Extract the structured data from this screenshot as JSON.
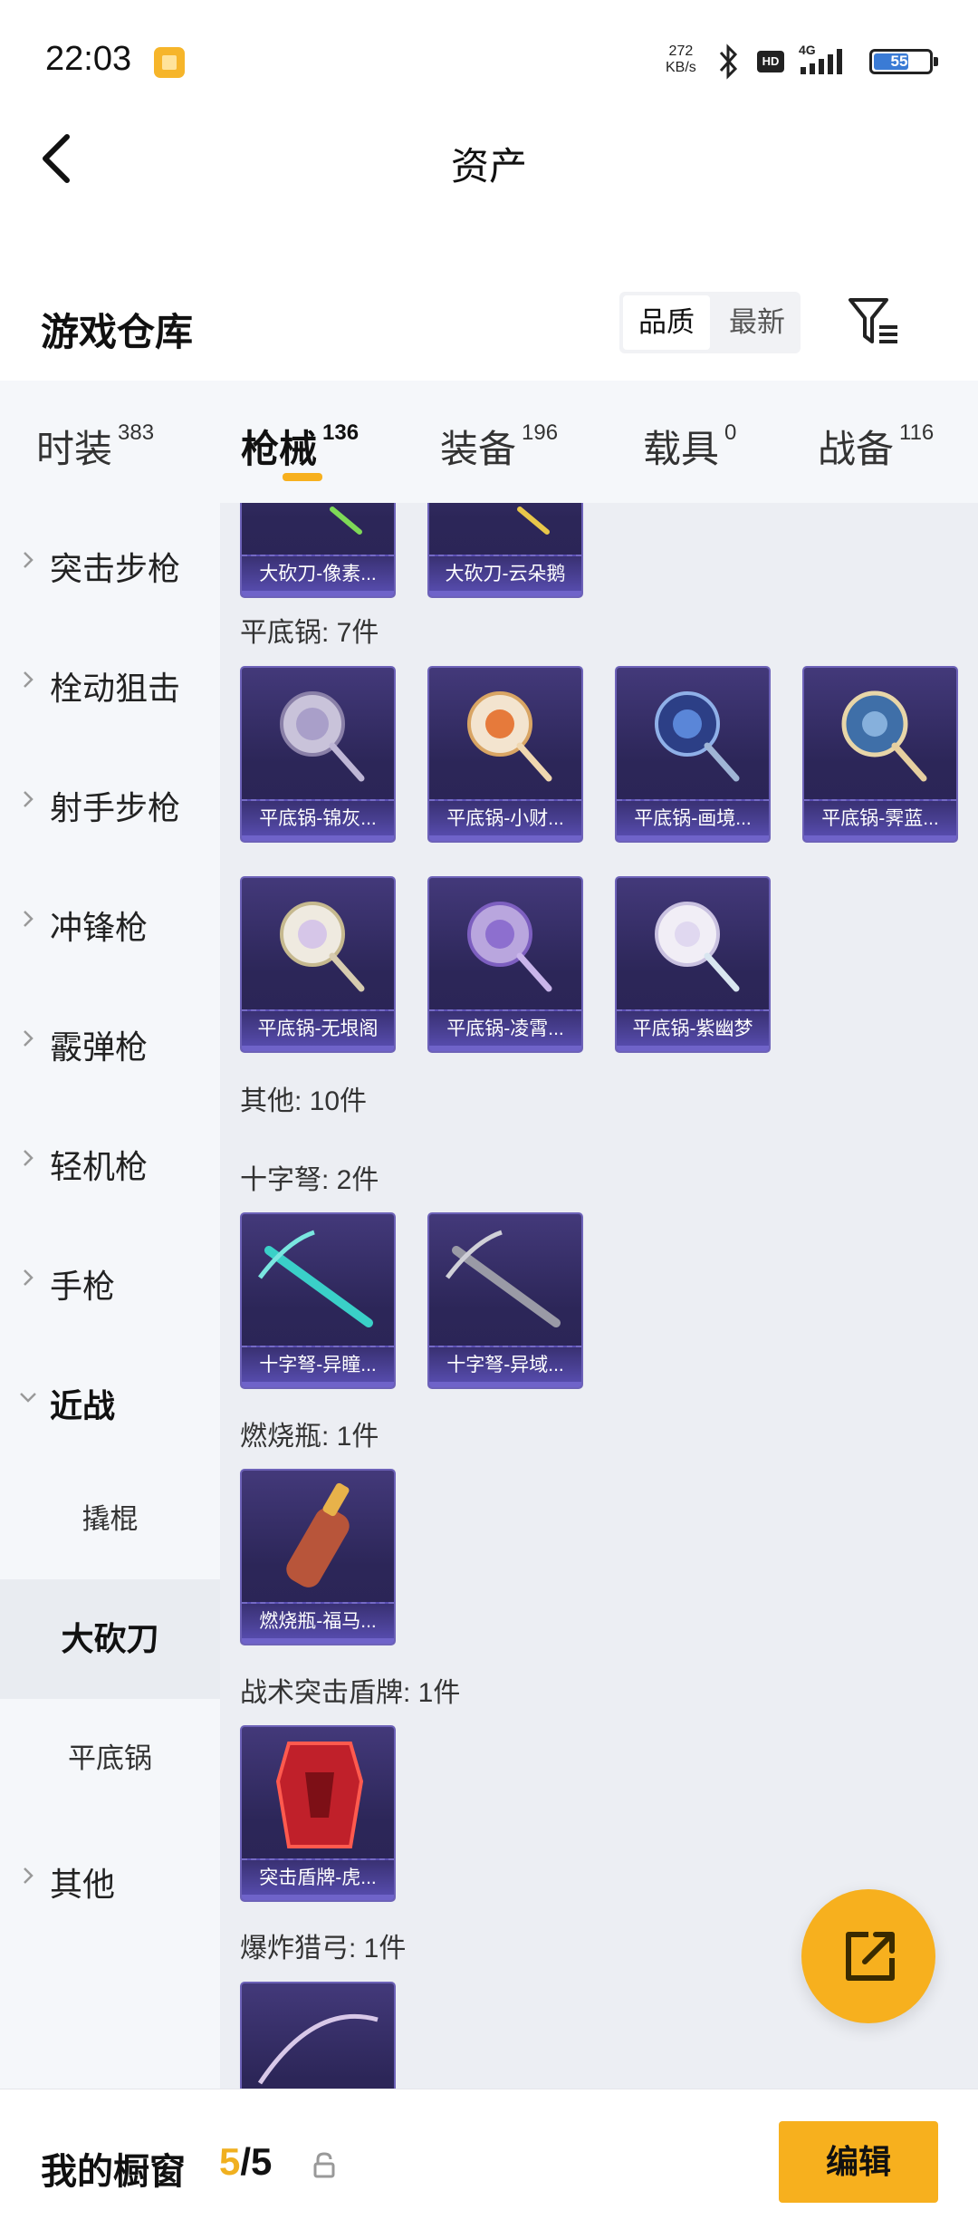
{
  "status": {
    "time": "22:03",
    "speed_value": "272",
    "speed_unit": "KB/s",
    "hd": "HD",
    "network": "4G",
    "battery": "55"
  },
  "header": {
    "title": "资产"
  },
  "warehouse": {
    "title": "游戏仓库",
    "sort_options": [
      "品质",
      "最新"
    ],
    "sort_selected": "品质"
  },
  "tabs": [
    {
      "label": "时装",
      "count": "383"
    },
    {
      "label": "枪械",
      "count": "136",
      "active": true
    },
    {
      "label": "装备",
      "count": "196"
    },
    {
      "label": "载具",
      "count": "0"
    },
    {
      "label": "战备",
      "count": "116"
    }
  ],
  "sidebar": {
    "items": [
      {
        "label": "突击步枪"
      },
      {
        "label": "栓动狙击"
      },
      {
        "label": "射手步枪"
      },
      {
        "label": "冲锋枪"
      },
      {
        "label": "霰弹枪"
      },
      {
        "label": "轻机枪"
      },
      {
        "label": "手枪"
      },
      {
        "label": "近战",
        "expanded": true
      }
    ],
    "sub_items": [
      {
        "label": "撬棍"
      },
      {
        "label": "大砍刀",
        "selected": true
      },
      {
        "label": "平底锅"
      }
    ],
    "last_item": {
      "label": "其他"
    }
  },
  "content": {
    "top_cards": [
      "大砍刀-像素...",
      "大砍刀-云朵鹅"
    ],
    "groups": [
      {
        "label": "平底锅: 7件",
        "items": [
          "平底锅-锦灰...",
          "平底锅-小财...",
          "平底锅-画境...",
          "平底锅-霁蓝...",
          "平底锅-无垠阁",
          "平底锅-凌霄...",
          "平底锅-紫幽梦"
        ]
      },
      {
        "label": "其他: 10件",
        "items": []
      },
      {
        "label": "十字弩: 2件",
        "items": [
          "十字弩-异瞳...",
          "十字弩-异域..."
        ]
      },
      {
        "label": "燃烧瓶: 1件",
        "items": [
          "燃烧瓶-福马..."
        ]
      },
      {
        "label": "战术突击盾牌: 1件",
        "items": [
          "突击盾牌-虎..."
        ]
      },
      {
        "label": "爆炸猎弓: 1件",
        "items": [
          ""
        ]
      }
    ]
  },
  "bottom": {
    "showcase_label": "我的橱窗",
    "showcase_current": "5",
    "showcase_total": "/5",
    "edit_label": "编辑"
  },
  "colors": {
    "accent": "#f7b01e",
    "card_bg": "#2c2658",
    "card_border": "#6d62b8",
    "sidebar_bg": "#f5f7fa",
    "content_bg": "#eceef3"
  }
}
